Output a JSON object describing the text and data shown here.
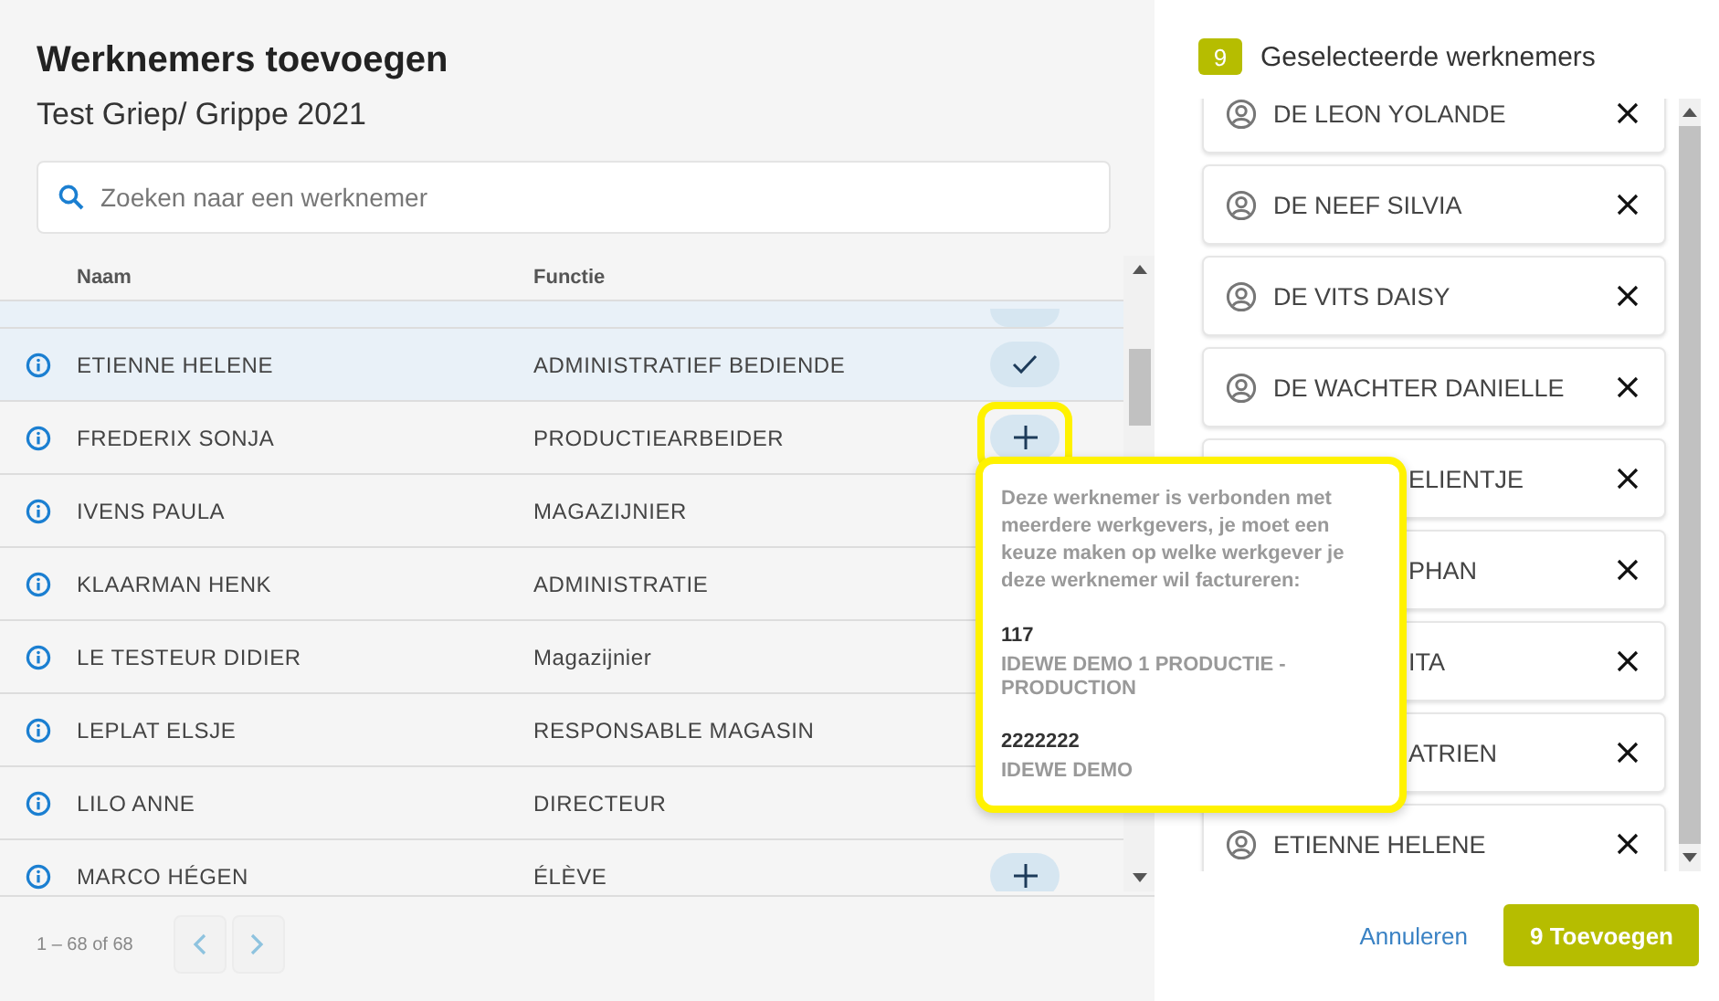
{
  "title": "Werknemers toevoegen",
  "subtitle": "Test Griep/ Grippe 2021",
  "search": {
    "placeholder": "Zoeken naar een werknemer"
  },
  "table": {
    "columns": [
      "Naam",
      "Functie"
    ],
    "partial_row": {
      "selected": true
    },
    "rows": [
      {
        "name": "ETIENNE HELENE",
        "function": "ADMINISTRATIEF BEDIENDE",
        "selected": true,
        "added": true,
        "highlighted": false
      },
      {
        "name": "FREDERIX SONJA",
        "function": "PRODUCTIEARBEIDER",
        "selected": false,
        "added": false,
        "highlighted": true
      },
      {
        "name": "IVENS PAULA",
        "function": "MAGAZIJNIER",
        "selected": false
      },
      {
        "name": "KLAARMAN HENK",
        "function": "ADMINISTRATIE",
        "selected": false
      },
      {
        "name": "LE TESTEUR DIDIER",
        "function": "Magazijnier",
        "selected": false
      },
      {
        "name": "LEPLAT ELSJE",
        "function": "RESPONSABLE MAGASIN",
        "selected": false
      },
      {
        "name": "LILO ANNE",
        "function": "DIRECTEUR",
        "selected": false
      },
      {
        "name": "MARCO HÉGEN",
        "function": "ÉLÈVE",
        "selected": false,
        "added": false,
        "highlighted": false
      }
    ]
  },
  "pagination": {
    "range": "1 – 68 of 68"
  },
  "popover": {
    "message": "Deze werknemer is verbonden met meerdere werkgevers, je moet een keuze maken op welke werkgever je deze werknemer wil factureren:",
    "highlighted": true,
    "options": [
      {
        "code": "117",
        "name": "IDEWE DEMO 1 PRODUCTIE - PRODUCTION"
      },
      {
        "code": "2222222",
        "name": "IDEWE DEMO"
      }
    ]
  },
  "selected_panel": {
    "count": "9",
    "title": "Geselecteerde werknemers",
    "items": [
      {
        "name": "DE LEON YOLANDE",
        "covered": false
      },
      {
        "name": "DE NEEF SILVIA",
        "covered": false
      },
      {
        "name": "DE VITS DAISY",
        "covered": false
      },
      {
        "name": "DE WACHTER DANIELLE",
        "covered": false
      },
      {
        "name": "ELIENTJE",
        "covered": true
      },
      {
        "name": "PHAN",
        "covered": true
      },
      {
        "name": "ITA",
        "covered": true
      },
      {
        "name": "ATRIEN",
        "covered": true
      },
      {
        "name": "ETIENNE HELENE",
        "covered": false
      }
    ]
  },
  "buttons": {
    "cancel": "Annuleren",
    "submit": "9 Toevoegen"
  }
}
